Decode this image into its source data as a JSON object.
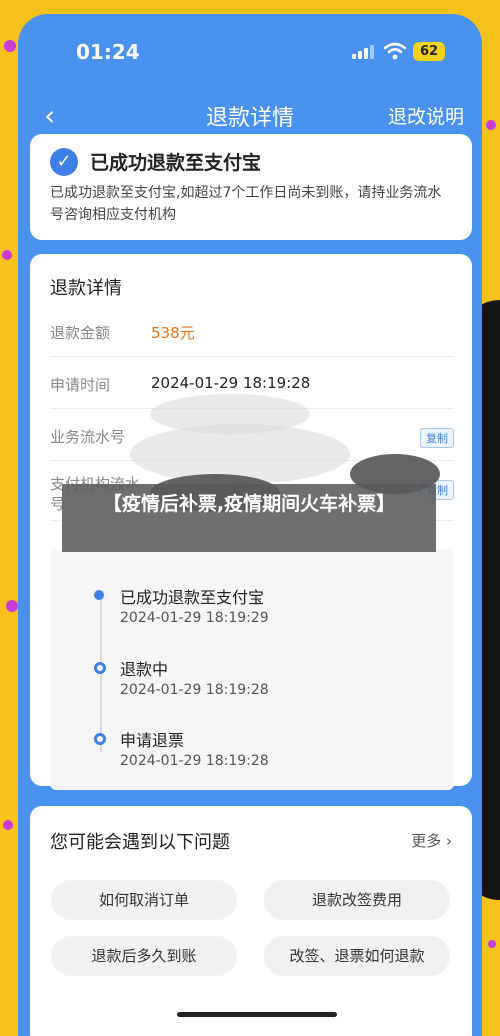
{
  "status_bar": {
    "time": "01:24",
    "battery": "62"
  },
  "nav": {
    "back_icon": "‹",
    "title": "退款详情",
    "action": "退改说明"
  },
  "success": {
    "title": "已成功退款至支付宝",
    "description": "已成功退款至支付宝,如超过7个工作日尚未到账，请持业务流水号咨询相应支付机构"
  },
  "detail": {
    "title": "退款详情",
    "rows": [
      {
        "label": "退款金额",
        "value": "538元"
      },
      {
        "label": "申请时间",
        "value": "2024-01-29 18:19:28"
      },
      {
        "label": "业务流水号",
        "action": "复制"
      },
      {
        "label": "支付机构流水号",
        "action": "复制"
      }
    ]
  },
  "overlay": {
    "text": "【疫情后补票,疫情期间火车补票】"
  },
  "timeline": [
    {
      "title": "已成功退款至支付宝",
      "time": "2024-01-29 18:19:29"
    },
    {
      "title": "退款中",
      "time": "2024-01-29 18:19:28"
    },
    {
      "title": "申请退票",
      "time": "2024-01-29 18:19:28"
    }
  ],
  "faq": {
    "title": "您可能会遇到以下问题",
    "more": "更多 ›",
    "items": [
      "如何取消订单",
      "退款改签费用",
      "退款后多久到账",
      "改签、退票如何退款"
    ]
  },
  "colors": {
    "accent": "#3d7fe6",
    "header": "#4a92ef",
    "money": "#e8731e",
    "background": "#f6c21a"
  }
}
